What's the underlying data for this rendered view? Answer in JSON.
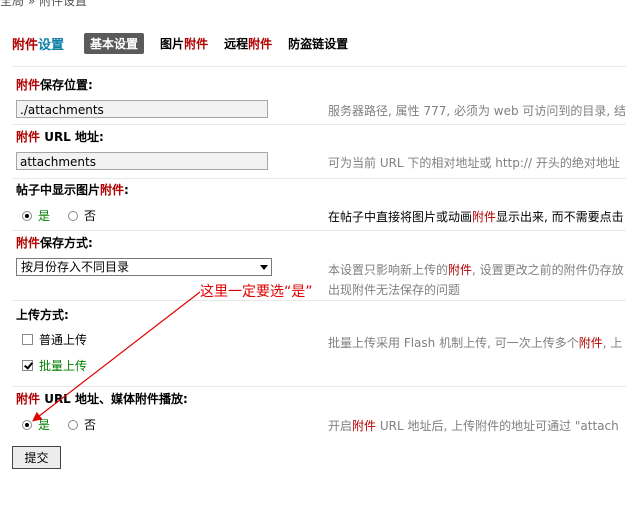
{
  "breadcrumb": "全局 » 附件设置",
  "page_title": {
    "part1": "附件",
    "part2": "设置"
  },
  "tabs": [
    {
      "label": "基本设置"
    },
    {
      "label_plain": "图片",
      "label_red": "附件"
    },
    {
      "label_plain": "远程",
      "label_red": "附件"
    },
    {
      "label": "防盗链设置"
    }
  ],
  "settings": {
    "save_location": {
      "label_red": "附件",
      "label": "保存位置:",
      "value": "./attachments",
      "desc": "服务器路径, 属性 777, 必须为 web 可访问到的目录, 结"
    },
    "url": {
      "label_red": "附件",
      "label": " URL 地址:",
      "value": "attachments",
      "desc": "可为当前 URL 下的相对地址或 http:// 开头的绝对地址"
    },
    "show_image": {
      "label": "帖子中显示图片",
      "label_red": "附件",
      "label_end": ":",
      "yes": "是",
      "no": "否",
      "desc_a": "在帖子中直接将图片或动画",
      "desc_red": "附件",
      "desc_b": "显示出来, 而不需要点击"
    },
    "save_method": {
      "label_red": "附件",
      "label": "保存方式:",
      "selected": "按月份存入不同目录",
      "desc_a": "本设置只影响新上传的",
      "desc_red": "附件",
      "desc_b": ", 设置更改之前的附件仍存放",
      "desc_line2": "出现附件无法保存的问题"
    },
    "upload_method": {
      "label": "上传方式:",
      "normal": "普通上传",
      "batch": "批量上传",
      "desc_a": "批量上传采用 Flash 机制上传, 可一次上传多个",
      "desc_red": "附件",
      "desc_b": ", 上"
    },
    "media_url": {
      "label_red": "附件",
      "label": " URL 地址、媒体附件播放:",
      "yes": "是",
      "no": "否",
      "desc_a": "开启",
      "desc_red": "附件",
      "desc_b": " URL 地址后, 上传附件的地址可通过 \"attach"
    }
  },
  "annotation": "这里一定要选“是”",
  "submit_label": "提交",
  "colors": {
    "accent_red": "#b00000",
    "annotation_red": "#e00000",
    "tab_active_bg": "#5a5a5a"
  }
}
